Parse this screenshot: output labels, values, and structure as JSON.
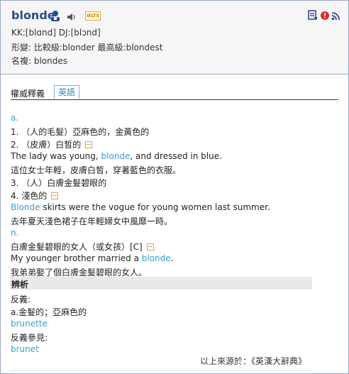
{
  "header": {
    "word": "blonde",
    "ielts_badge": "IELTS",
    "icons": [
      "word-icon",
      "speaker-icon",
      "ielts-badge",
      "wordbook-icon",
      "report-icon",
      "rss-icon"
    ],
    "pron": "KK:[blɑnd]  DJ:[blɔnd]",
    "forms": "形變: 比較級:blonder  最高級:blondest",
    "plural": "名複: blondes"
  },
  "tabs": {
    "authority": "權威釋義",
    "english": "英語"
  },
  "entries": {
    "pos_a": "a.",
    "s1": "1. （人的毛髮）亞麻色的，金黃色的",
    "s2": "2. （皮膚）白皙的",
    "ex1_pre": "The lady was young, ",
    "ex1_word": "blonde",
    "ex1_post": ", and dressed in blue.",
    "ex1_zh": "這位女士年輕，皮膚白皙，穿著藍色的衣服。",
    "s3": "3. （人）白膚金髮碧眼的",
    "s4": "4. 淺色的",
    "ex2_word": "Blonde",
    "ex2_post": " skirts were the vogue for young women last summer.",
    "ex2_zh": "去年夏天淺色裙子在年輕婦女中風靡一時。",
    "pos_n": "n.",
    "n1": "白膚金髮碧眼的女人（或女孩）[C]",
    "ex3_pre": "My younger brother married a ",
    "ex3_word": "blonde",
    "ex3_post": ".",
    "ex3_zh": "我弟弟娶了個白膚金髮碧眼的女人。"
  },
  "analysis": {
    "title": "辨析",
    "antonym_label": "反義:",
    "antonym_sense": "a.金髮的；亞麻色的",
    "antonym_word": "brunette",
    "see_label": "反義參見:",
    "see_word": "brunet"
  },
  "source": "以上來源於：《英漢大辭典》",
  "colors": {
    "link": "#3b9fd1",
    "title": "#2b4c8c",
    "border": "#9aa9c8"
  }
}
